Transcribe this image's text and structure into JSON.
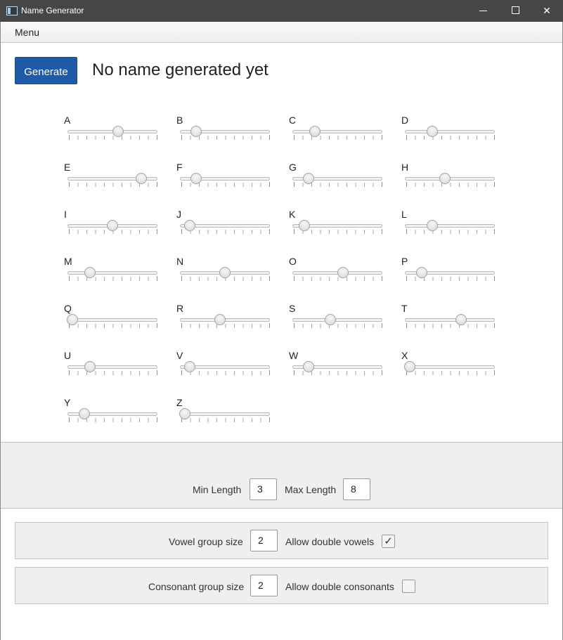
{
  "window": {
    "title": "Name Generator",
    "icon": "app-window-icon"
  },
  "menubar": {
    "menu_label": "Menu"
  },
  "toolbar": {
    "generate_label": "Generate",
    "result_text": "No name generated yet"
  },
  "sliders": [
    {
      "letter": "A",
      "value": 0.54
    },
    {
      "letter": "B",
      "value": 0.15
    },
    {
      "letter": "C",
      "value": 0.22
    },
    {
      "letter": "D",
      "value": 0.28
    },
    {
      "letter": "E",
      "value": 0.8
    },
    {
      "letter": "F",
      "value": 0.15
    },
    {
      "letter": "G",
      "value": 0.15
    },
    {
      "letter": "H",
      "value": 0.42
    },
    {
      "letter": "I",
      "value": 0.48
    },
    {
      "letter": "J",
      "value": 0.08
    },
    {
      "letter": "K",
      "value": 0.1
    },
    {
      "letter": "L",
      "value": 0.28
    },
    {
      "letter": "M",
      "value": 0.22
    },
    {
      "letter": "N",
      "value": 0.48
    },
    {
      "letter": "O",
      "value": 0.54
    },
    {
      "letter": "P",
      "value": 0.16
    },
    {
      "letter": "Q",
      "value": 0.02
    },
    {
      "letter": "R",
      "value": 0.42
    },
    {
      "letter": "S",
      "value": 0.4
    },
    {
      "letter": "T",
      "value": 0.6
    },
    {
      "letter": "U",
      "value": 0.22
    },
    {
      "letter": "V",
      "value": 0.08
    },
    {
      "letter": "W",
      "value": 0.15
    },
    {
      "letter": "X",
      "value": 0.02
    },
    {
      "letter": "Y",
      "value": 0.16
    },
    {
      "letter": "Z",
      "value": 0.02
    }
  ],
  "length": {
    "min_label": "Min Length",
    "min_value": "3",
    "max_label": "Max Length",
    "max_value": "8"
  },
  "vowels": {
    "group_label": "Vowel group size",
    "group_value": "2",
    "double_label": "Allow double vowels",
    "double_checked": true
  },
  "consonants": {
    "group_label": "Consonant group size",
    "group_value": "2",
    "double_label": "Allow double consonants",
    "double_checked": false
  }
}
